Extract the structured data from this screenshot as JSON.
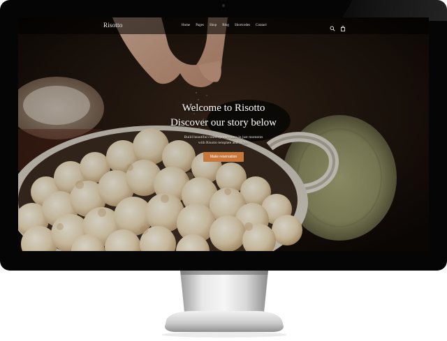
{
  "site": {
    "logo": "Risotto"
  },
  "nav": {
    "items": [
      "Home",
      "Pages",
      "Shop",
      "Blog",
      "Shortcodes",
      "Contact"
    ],
    "icons": [
      "search-icon",
      "bag-icon"
    ]
  },
  "hero": {
    "title_line1": "Welcome to Risotto",
    "title_line2": "Discover our story below",
    "subtitle_line1": "Build beautiful contemporary sites in just moments",
    "subtitle_line2": "with Risotto template and SCSS.",
    "cta_label": "Make reservation"
  },
  "colors": {
    "accent": "#c8773c",
    "bezel": "#050505"
  }
}
